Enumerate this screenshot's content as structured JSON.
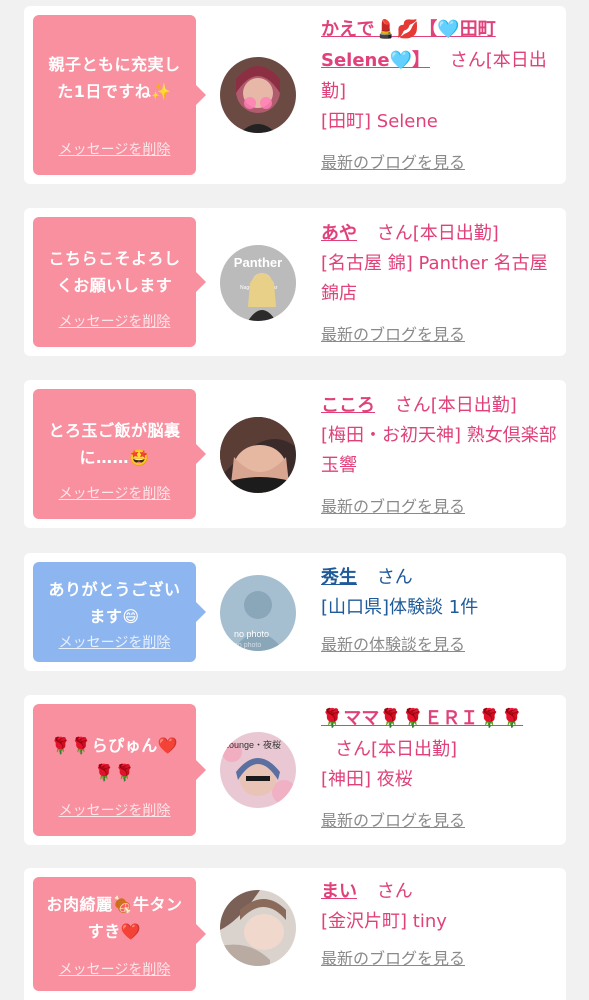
{
  "messages": [
    {
      "message": "親子ともに充実した1日ですね✨",
      "delete_label": "メッセージを削除",
      "name": "かえで💄💋【🩵田町Selene🩵】",
      "honorific": "さん",
      "status": "[本日出勤]",
      "shop": "[田町] Selene",
      "link": "最新のブログを見る"
    },
    {
      "message": "こちらこそよろしくお願いします",
      "delete_label": "メッセージを削除",
      "name": "あや",
      "honorific": "さん",
      "status": "[本日出勤]",
      "shop": "[名古屋 錦] Panther 名古屋錦店",
      "link": "最新のブログを見る"
    },
    {
      "message": "とろ玉ご飯が脳裏に……🤩",
      "delete_label": "メッセージを削除",
      "name": "こころ",
      "honorific": "さん",
      "status": "[本日出勤]",
      "shop": "[梅田・お初天神] 熟女倶楽部 玉響",
      "link": "最新のブログを見る"
    },
    {
      "message": "ありがとうございます😄",
      "delete_label": "メッセージを削除",
      "name": "秀生",
      "honorific": "さん",
      "status": "",
      "shop": "[山口県]体験談 1件",
      "link": "最新の体験談を見る"
    },
    {
      "message": "🌹🌹らぴゅん❤️🌹🌹",
      "delete_label": "メッセージを削除",
      "name": "🌹ママ🌹🌹ＥＲＩ🌹🌹",
      "honorific": "さん",
      "status": "[本日出勤]",
      "shop": "[神田] 夜桜",
      "link": "最新のブログを見る"
    },
    {
      "message": "お肉綺麗🍖牛タンすき❤️",
      "delete_label": "メッセージを削除",
      "name": "まい",
      "honorific": "さん",
      "status": "",
      "shop": "[金沢片町] tiny",
      "link": "最新のブログを見る"
    }
  ],
  "avatar_texts": {
    "panther": "Panther",
    "panther_sub": "Nagoya girls' bar",
    "nophoto": "no photo",
    "nophoto_sub": "no photo",
    "lounge": "Lounge・夜桜"
  },
  "colors": {
    "pink_bubble": "#f9909f",
    "blue_bubble": "#8db6f1",
    "pink_text": "#e0417a",
    "blue_text": "#1f5a99",
    "link_gray": "#8a8a8a",
    "background": "#f1f1f1"
  }
}
